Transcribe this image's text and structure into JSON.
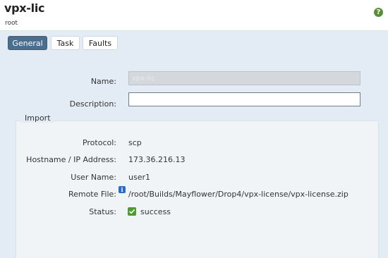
{
  "header": {
    "title": "vpx-lic",
    "subtitle": "root",
    "help_icon": "question-circle-icon",
    "help_glyph": "?"
  },
  "tabs": [
    {
      "label": "General",
      "active": true
    },
    {
      "label": "Task",
      "active": false
    },
    {
      "label": "Faults",
      "active": false
    }
  ],
  "form": {
    "name_label": "Name:",
    "name_value": "vpx-lic",
    "description_label": "Description:",
    "description_value": ""
  },
  "import": {
    "legend": "Import",
    "protocol_label": "Protocol:",
    "protocol_value": "scp",
    "hostname_label": "Hostname / IP Address:",
    "hostname_value": "173.36.216.13",
    "username_label": "User Name:",
    "username_value": "user1",
    "remote_file_label": "Remote File:",
    "remote_file_value": "/root/Builds/Mayflower/Drop4/vpx-license/vpx-license.zip",
    "info_glyph": "i",
    "status_label": "Status:",
    "status_value": "success"
  },
  "colors": {
    "tab_active": "#4b6e8d",
    "background": "#e3ebf4",
    "success_green": "#4f9a33",
    "info_blue": "#2a6bc4"
  }
}
